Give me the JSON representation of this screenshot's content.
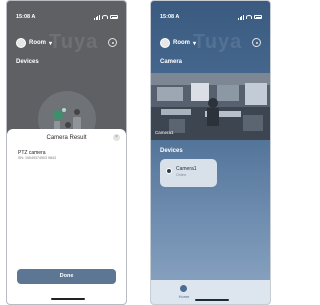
{
  "left_screen": {
    "status_time": "15:08 A",
    "home_label": "Room",
    "section_devices": "Devices",
    "sheet": {
      "title": "Camera Result",
      "close_glyph": "×",
      "camera_name": "PTZ camera",
      "serial": "SN: 19049374903 9843",
      "done_label": "Done"
    }
  },
  "right_screen": {
    "status_time": "15:08 A",
    "home_label": "Room",
    "section_camera": "Camera",
    "feed_label": "Camera1",
    "section_devices": "Devices",
    "device": {
      "name": "Camera1",
      "status": "Online"
    },
    "tab": {
      "label": "Home"
    }
  },
  "watermark": "Tuya"
}
